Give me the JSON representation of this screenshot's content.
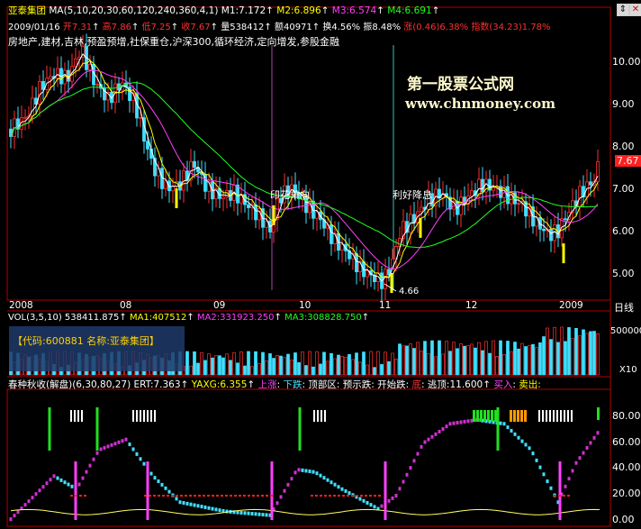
{
  "stock": {
    "name": "亚泰集团",
    "code_label": "【代码:600881 名称:亚泰集团】"
  },
  "header": {
    "ma_spec": "MA(5,10,20,30,60,120,240,360,4,1)",
    "m1": "M1:7.172",
    "m2": "M2:6.896",
    "m3": "M3:6.574",
    "m4": "M4:6.691",
    "date": "2009/01/16",
    "open": "开7.31",
    "high": "高7.86",
    "low": "低7.25",
    "close": "收7.67",
    "vol": "量538412",
    "amt": "额40971",
    "turnover": "换4.56%",
    "amplitude": "振8.48%",
    "change": "涨(0.46)6.38%",
    "index": "指数(34.23)1.78%",
    "sectors": "房地产,建材,吉林,预盈预增,社保重仓,沪深300,循环经济,定向增发,参股金融"
  },
  "watermark": {
    "line1": "第一股票公式网",
    "line2": "www.chnmoney.com"
  },
  "annotations": {
    "a1": "印花单向",
    "a2": "利好降息",
    "low_label": "4.66"
  },
  "price_axis": {
    "labels": [
      "10.00",
      "9.00",
      "8.00",
      "7.00",
      "6.00",
      "5.00"
    ],
    "last_price": "7.67"
  },
  "time_axis": {
    "labels": [
      "2008",
      "08",
      "09",
      "10",
      "11",
      "12",
      "2009"
    ],
    "period": "日线"
  },
  "volume": {
    "spec": "VOL(3,5,10)",
    "v": "538411.875",
    "ma1": "MA1:407512",
    "ma2": "MA2:331923.250",
    "ma3": "MA3:308828.750",
    "axis_label": "500000",
    "axis_unit": "X10"
  },
  "indicator": {
    "name": "春种秋收(解盘)",
    "params": "(6,30,80,27)",
    "ert": "ERT:7.363",
    "yaxg": "YAXG:6.355",
    "up": "上涨",
    "down": "下跌",
    "top": "顶部区",
    "warn": "预示跌",
    "start": "开始跌",
    "bottom": "底",
    "escape": "逃顶:11.600",
    "buy": "买入",
    "sell": "卖出:",
    "axis_labels": [
      "80.00",
      "60.00",
      "40.00",
      "20.00",
      "0.00"
    ]
  },
  "colors": {
    "up": "#ff3030",
    "down": "#40e0ff",
    "ma5": "#ffffff",
    "ma10": "#ffff00",
    "ma20": "#ff40ff",
    "ma30": "#20ff20",
    "marker": "#ffff00"
  }
}
